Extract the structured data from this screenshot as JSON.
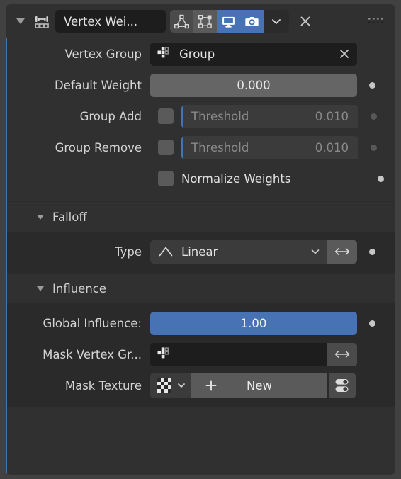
{
  "modifier": {
    "name": "Vertex Wei...",
    "type_icon": "vertex-weight-edit-icon",
    "expand_icon": "triangle-down-icon",
    "toggles": [
      {
        "name": "show-in-edit-mode",
        "icon": "edit-mode-icon",
        "active": false
      },
      {
        "name": "show-on-cage",
        "icon": "on-cage-icon",
        "active": false
      },
      {
        "name": "show-in-viewport",
        "icon": "monitor-icon",
        "active": true
      },
      {
        "name": "show-in-render",
        "icon": "camera-icon",
        "active": true
      }
    ],
    "dropdown_icon": "chevron-down-icon",
    "close_icon": "close-x-icon",
    "drag_icon": "drag-dots-icon"
  },
  "rows": {
    "vertex_group": {
      "label": "Vertex Group",
      "value": "Group",
      "icon": "vertex-group-icon",
      "clear_icon": "close-x-icon"
    },
    "default_weight": {
      "label": "Default Weight",
      "value": "0.000",
      "decorator": "animate-dot-on"
    },
    "group_add": {
      "label": "Group Add",
      "checked": false,
      "threshold_label": "Threshold",
      "threshold_value": "0.010",
      "decorator": "animate-dot-off"
    },
    "group_remove": {
      "label": "Group Remove",
      "checked": false,
      "threshold_label": "Threshold",
      "threshold_value": "0.010",
      "decorator": "animate-dot-off"
    },
    "normalize_weights": {
      "label": "Normalize Weights",
      "checked": false,
      "decorator": "animate-dot-on"
    }
  },
  "falloff": {
    "title": "Falloff",
    "type_label": "Type",
    "type_value": "Linear",
    "type_icon": "linear-curve-icon",
    "chevron_icon": "chevron-down-icon",
    "invert_icon": "left-right-arrow-icon",
    "decorator": "animate-dot-on"
  },
  "influence": {
    "title": "Influence",
    "global_influence": {
      "label": "Global Influence:",
      "value": "1.00",
      "decorator": "animate-dot-on"
    },
    "mask_vertex_group": {
      "label": "Mask Vertex Gr...",
      "value": "",
      "icon": "vertex-group-icon",
      "invert_icon": "left-right-arrow-icon"
    },
    "mask_texture": {
      "label": "Mask Texture",
      "browse_icon": "checker-texture-icon",
      "chevron_icon": "chevron-down-icon",
      "new_label": "New",
      "plus_icon": "plus-icon",
      "options_icon": "texture-options-icon"
    }
  },
  "colors": {
    "accent": "#4772b3",
    "panel_bg": "#303030",
    "subpanel_bg": "#2a2a2a",
    "field_dark": "#1d1d1d",
    "field_grey": "#656565",
    "text": "#d4d4d4"
  }
}
